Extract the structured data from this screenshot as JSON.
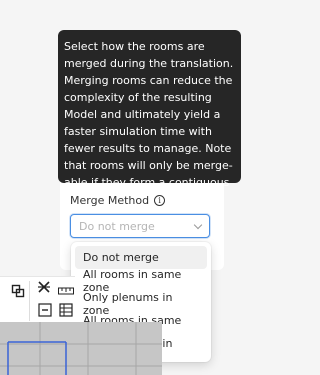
{
  "tooltip": {
    "text": "Select how the rooms are merged during the translation. Merging rooms can reduce the complexity of the resulting Model and ultimately yield a faster simulation time with fewer results to manage. Note that rooms will only be merge-able if they form a contiguous volume across their solved adjacencies."
  },
  "merge_method": {
    "label": "Merge Method",
    "placeholder": "Do not merge",
    "options": [
      "Do not merge",
      "All rooms in same zone",
      "Only plenums in zone",
      "All rooms in same story",
      "Only plenums in story"
    ]
  },
  "colors": {
    "tooltip_bg": "#262626",
    "focus_border": "#4a8fe3",
    "selected_option_bg": "#f0f0f0",
    "viewport_grid_line": "#3a63d6"
  },
  "icons": [
    "info-icon",
    "chevron-down-icon",
    "copy-icon",
    "scissor-icon",
    "measure-icon",
    "minus-icon",
    "grid-icon"
  ]
}
